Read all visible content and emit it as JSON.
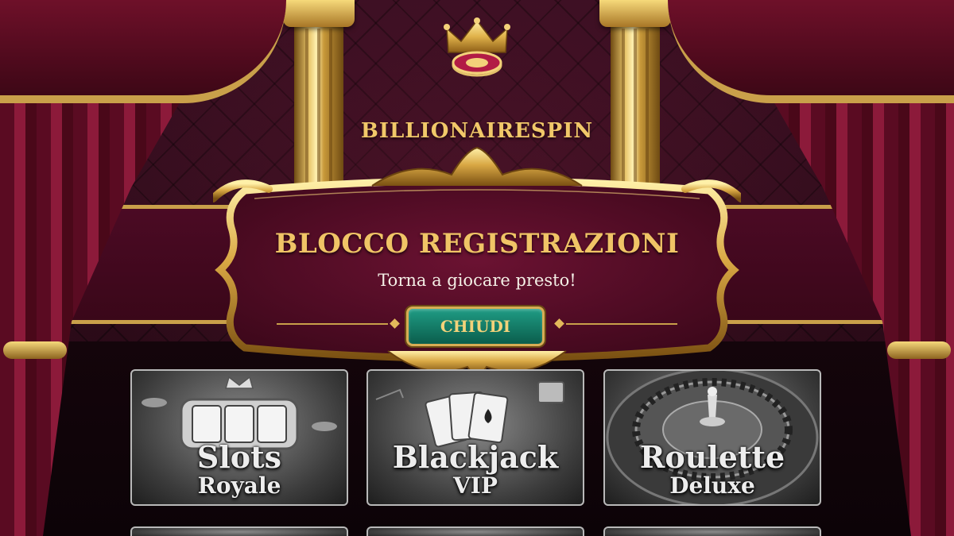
{
  "brand": {
    "name": "BILLIONAIRESPIN",
    "icon": "crown-chip-icon"
  },
  "dialog": {
    "title": "BLOCCO REGISTRAZIONI",
    "subtitle": "Torna a giocare presto!",
    "close_label": "CHIUDI"
  },
  "games": [
    {
      "title_line1": "Slots",
      "title_line2": "Royale",
      "icon": "slot-machine-icon"
    },
    {
      "title_line1": "Blackjack",
      "title_line2": "VIP",
      "icon": "playing-cards-icon"
    },
    {
      "title_line1": "Roulette",
      "title_line2": "Deluxe",
      "icon": "roulette-wheel-icon"
    }
  ],
  "colors": {
    "gold": "#c9a04a",
    "burgundy": "#4b0a24",
    "button_teal": "#1f9c84",
    "title_gold": "#f0c466"
  }
}
